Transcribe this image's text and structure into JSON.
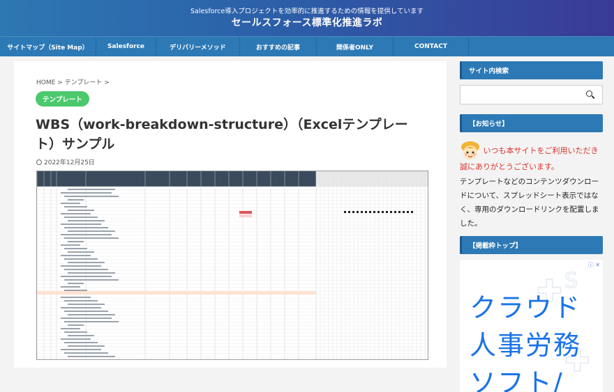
{
  "header": {
    "tagline": "Salesforce導入プロジェクトを効率的に推進するための情報を提供しています",
    "site_title": "セールスフォース標準化推進ラボ"
  },
  "nav": {
    "items": [
      {
        "label": "サイトマップ（Site Map）"
      },
      {
        "label": "Salesforce"
      },
      {
        "label": "デリバリーメソッド"
      },
      {
        "label": "おすすめの記事"
      },
      {
        "label": "関係者ONLY"
      },
      {
        "label": "CONTACT"
      }
    ]
  },
  "breadcrumb": {
    "home": "HOME",
    "sep1": ">",
    "category": "テンプレート",
    "sep2": ">"
  },
  "post": {
    "category": "テンプレート",
    "title": "WBS（work-breakdown-structure）（Excelテンプレート）サンプル",
    "date": "2022年12月25日"
  },
  "sidebar": {
    "search_heading": "サイト内検索",
    "search_icon": "search-icon",
    "notice_heading": "【お知らせ】",
    "notice_red": "いつも本サイトをご利用いただき誠にありがとうございます。",
    "notice_body": "テンプレートなどのコンテンツダウンロードについて、スプレッドシート表示ではなく、専用のダウンロードリンクを配置しました。",
    "ad_heading": "【掲載枠トップ】",
    "ad_info_icon": "info-icon",
    "ad_lines": [
      "クラウド",
      "人事労務",
      "ソフト/"
    ]
  },
  "colors": {
    "header_start": "#2d78b3",
    "header_end": "#3a3a96",
    "nav_bg": "#2d79b5",
    "badge_green": "#4cc96d",
    "notice_red": "#d9322b",
    "ad_blue": "#1a73e8"
  }
}
